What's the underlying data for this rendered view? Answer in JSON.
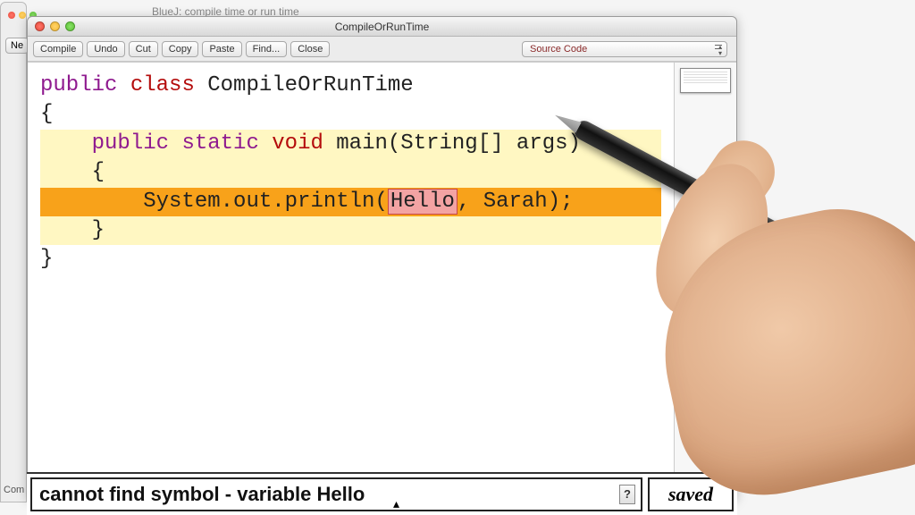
{
  "background_window": {
    "title": "BlueJ: compile time or run time",
    "partial_button": "Ne",
    "partial_label": "Com"
  },
  "window": {
    "title": "CompileOrRunTime"
  },
  "toolbar": {
    "compile": "Compile",
    "undo": "Undo",
    "cut": "Cut",
    "copy": "Copy",
    "paste": "Paste",
    "find": "Find...",
    "close": "Close",
    "view_mode": "Source Code"
  },
  "code": {
    "line1_kw1": "public",
    "line1_kw2": "class",
    "line1_name": " CompileOrRunTime",
    "line2": "{",
    "line3_kw1": "public",
    "line3_kw2": "static",
    "line3_kw3": "void",
    "line3_rest": " main(String[] args)",
    "line4": "    {",
    "line5_pre": "        System.out.println(",
    "line5_err": "Hello",
    "line5_post": ", Sarah);",
    "line6": "    }",
    "line7": "}"
  },
  "status": {
    "error_message": "cannot find symbol -   variable Hello",
    "help": "?",
    "saved": "saved"
  },
  "colors": {
    "keyword_purple": "#8f1a8f",
    "keyword_red": "#b40c0c",
    "highlight_block": "#fff7c2",
    "highlight_error_line": "#f8a21a",
    "error_token_bg": "#f3a3a3"
  }
}
